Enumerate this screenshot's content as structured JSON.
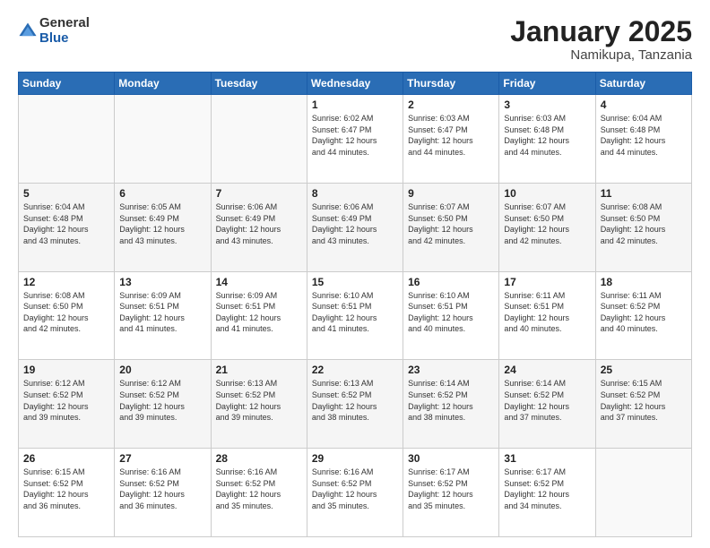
{
  "logo": {
    "general": "General",
    "blue": "Blue"
  },
  "header": {
    "title": "January 2025",
    "subtitle": "Namikupa, Tanzania"
  },
  "weekdays": [
    "Sunday",
    "Monday",
    "Tuesday",
    "Wednesday",
    "Thursday",
    "Friday",
    "Saturday"
  ],
  "weeks": [
    [
      {
        "day": "",
        "info": ""
      },
      {
        "day": "",
        "info": ""
      },
      {
        "day": "",
        "info": ""
      },
      {
        "day": "1",
        "info": "Sunrise: 6:02 AM\nSunset: 6:47 PM\nDaylight: 12 hours\nand 44 minutes."
      },
      {
        "day": "2",
        "info": "Sunrise: 6:03 AM\nSunset: 6:47 PM\nDaylight: 12 hours\nand 44 minutes."
      },
      {
        "day": "3",
        "info": "Sunrise: 6:03 AM\nSunset: 6:48 PM\nDaylight: 12 hours\nand 44 minutes."
      },
      {
        "day": "4",
        "info": "Sunrise: 6:04 AM\nSunset: 6:48 PM\nDaylight: 12 hours\nand 44 minutes."
      }
    ],
    [
      {
        "day": "5",
        "info": "Sunrise: 6:04 AM\nSunset: 6:48 PM\nDaylight: 12 hours\nand 43 minutes."
      },
      {
        "day": "6",
        "info": "Sunrise: 6:05 AM\nSunset: 6:49 PM\nDaylight: 12 hours\nand 43 minutes."
      },
      {
        "day": "7",
        "info": "Sunrise: 6:06 AM\nSunset: 6:49 PM\nDaylight: 12 hours\nand 43 minutes."
      },
      {
        "day": "8",
        "info": "Sunrise: 6:06 AM\nSunset: 6:49 PM\nDaylight: 12 hours\nand 43 minutes."
      },
      {
        "day": "9",
        "info": "Sunrise: 6:07 AM\nSunset: 6:50 PM\nDaylight: 12 hours\nand 42 minutes."
      },
      {
        "day": "10",
        "info": "Sunrise: 6:07 AM\nSunset: 6:50 PM\nDaylight: 12 hours\nand 42 minutes."
      },
      {
        "day": "11",
        "info": "Sunrise: 6:08 AM\nSunset: 6:50 PM\nDaylight: 12 hours\nand 42 minutes."
      }
    ],
    [
      {
        "day": "12",
        "info": "Sunrise: 6:08 AM\nSunset: 6:50 PM\nDaylight: 12 hours\nand 42 minutes."
      },
      {
        "day": "13",
        "info": "Sunrise: 6:09 AM\nSunset: 6:51 PM\nDaylight: 12 hours\nand 41 minutes."
      },
      {
        "day": "14",
        "info": "Sunrise: 6:09 AM\nSunset: 6:51 PM\nDaylight: 12 hours\nand 41 minutes."
      },
      {
        "day": "15",
        "info": "Sunrise: 6:10 AM\nSunset: 6:51 PM\nDaylight: 12 hours\nand 41 minutes."
      },
      {
        "day": "16",
        "info": "Sunrise: 6:10 AM\nSunset: 6:51 PM\nDaylight: 12 hours\nand 40 minutes."
      },
      {
        "day": "17",
        "info": "Sunrise: 6:11 AM\nSunset: 6:51 PM\nDaylight: 12 hours\nand 40 minutes."
      },
      {
        "day": "18",
        "info": "Sunrise: 6:11 AM\nSunset: 6:52 PM\nDaylight: 12 hours\nand 40 minutes."
      }
    ],
    [
      {
        "day": "19",
        "info": "Sunrise: 6:12 AM\nSunset: 6:52 PM\nDaylight: 12 hours\nand 39 minutes."
      },
      {
        "day": "20",
        "info": "Sunrise: 6:12 AM\nSunset: 6:52 PM\nDaylight: 12 hours\nand 39 minutes."
      },
      {
        "day": "21",
        "info": "Sunrise: 6:13 AM\nSunset: 6:52 PM\nDaylight: 12 hours\nand 39 minutes."
      },
      {
        "day": "22",
        "info": "Sunrise: 6:13 AM\nSunset: 6:52 PM\nDaylight: 12 hours\nand 38 minutes."
      },
      {
        "day": "23",
        "info": "Sunrise: 6:14 AM\nSunset: 6:52 PM\nDaylight: 12 hours\nand 38 minutes."
      },
      {
        "day": "24",
        "info": "Sunrise: 6:14 AM\nSunset: 6:52 PM\nDaylight: 12 hours\nand 37 minutes."
      },
      {
        "day": "25",
        "info": "Sunrise: 6:15 AM\nSunset: 6:52 PM\nDaylight: 12 hours\nand 37 minutes."
      }
    ],
    [
      {
        "day": "26",
        "info": "Sunrise: 6:15 AM\nSunset: 6:52 PM\nDaylight: 12 hours\nand 36 minutes."
      },
      {
        "day": "27",
        "info": "Sunrise: 6:16 AM\nSunset: 6:52 PM\nDaylight: 12 hours\nand 36 minutes."
      },
      {
        "day": "28",
        "info": "Sunrise: 6:16 AM\nSunset: 6:52 PM\nDaylight: 12 hours\nand 35 minutes."
      },
      {
        "day": "29",
        "info": "Sunrise: 6:16 AM\nSunset: 6:52 PM\nDaylight: 12 hours\nand 35 minutes."
      },
      {
        "day": "30",
        "info": "Sunrise: 6:17 AM\nSunset: 6:52 PM\nDaylight: 12 hours\nand 35 minutes."
      },
      {
        "day": "31",
        "info": "Sunrise: 6:17 AM\nSunset: 6:52 PM\nDaylight: 12 hours\nand 34 minutes."
      },
      {
        "day": "",
        "info": ""
      }
    ]
  ]
}
